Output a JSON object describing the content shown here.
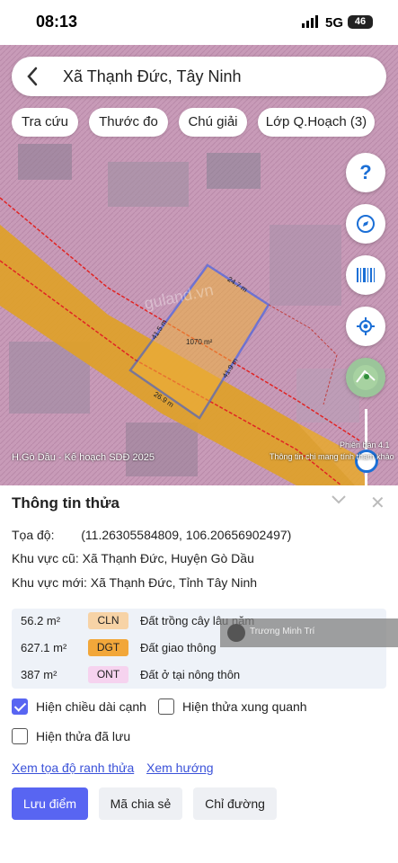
{
  "status_bar": {
    "time": "08:13",
    "network": "5G",
    "battery": "46"
  },
  "search": {
    "title": "Xã Thạnh Đức, Tây Ninh"
  },
  "chips": [
    "Tra cứu",
    "Thước đo",
    "Chú giải",
    "Lớp Q.Hoạch (3)"
  ],
  "map": {
    "caption": "H.Gò Dầu - Kế hoạch SDĐ 2025",
    "scale_label": "Phiên bản 4.1",
    "info_link": "Thông tin chi mang tính tham khảo",
    "parcel_area": "1070 m²",
    "edge_top": "24.7 m",
    "edge_left": "41.5 m",
    "edge_right": "41.9 m",
    "edge_bottom": "26.9 m",
    "watermark_site": "guland.vn",
    "colors": {
      "planning_yellow": "#e7a92c",
      "residential_pink": "#d8a3c9",
      "parcel_outline": "#2a55e8"
    }
  },
  "sheet": {
    "title": "Thông tin thửa",
    "coords_label": "Tọa độ:",
    "coords_value": "(11.26305584809, 106.20656902497)",
    "old_area_label": "Khu vực cũ:",
    "old_area_value": "Xã Thạnh Đức, Huyện Gò Dầu",
    "new_area_label": "Khu vực mới:",
    "new_area_value": "Xã Thạnh Đức, Tỉnh Tây Ninh",
    "land_uses": [
      {
        "area": "56.2 m²",
        "code": "CLN",
        "name": "Đất trồng cây lâu năm",
        "color": "#f7d3a6"
      },
      {
        "area": "627.1 m²",
        "code": "DGT",
        "name": "Đất giao thông",
        "color": "#f2a73a"
      },
      {
        "area": "387 m²",
        "code": "ONT",
        "name": "Đất ở tại nông thôn",
        "color": "#f6d3ef"
      }
    ],
    "watermark_name": "Trương Minh Trí",
    "checkbox_edge_lengths": "Hiện chiều dài cạnh",
    "checkbox_surrounding": "Hiện thửa xung quanh",
    "checkbox_saved": "Hiện thửa đã lưu",
    "link_coords": "Xem tọa độ ranh thửa",
    "link_direction": "Xem hướng",
    "btn_save": "Lưu điểm",
    "btn_share": "Mã chia sẻ",
    "btn_route": "Chỉ đường"
  }
}
